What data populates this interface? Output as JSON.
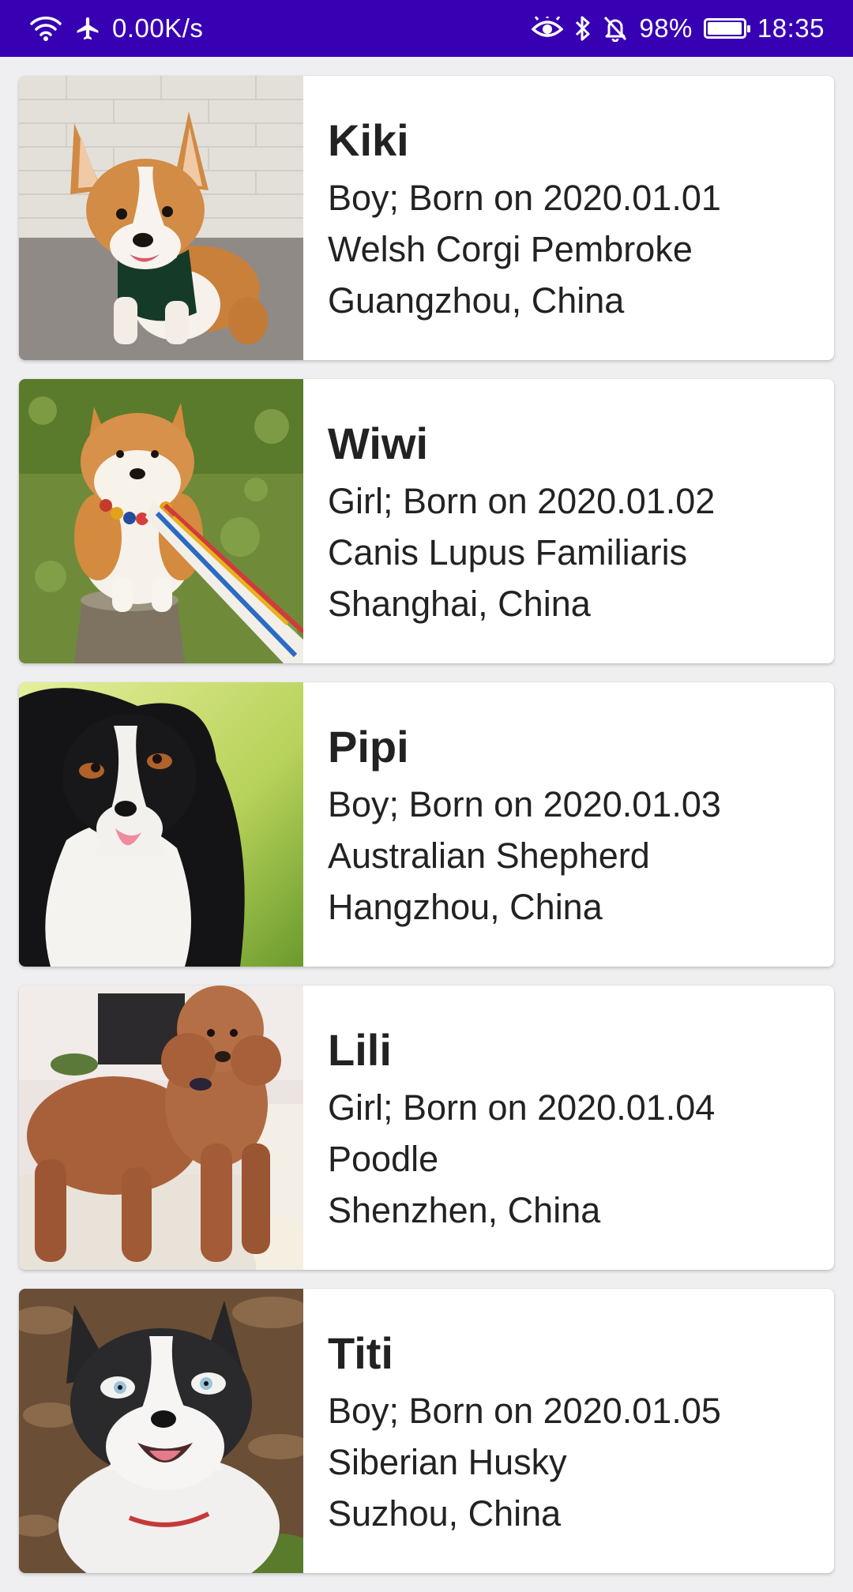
{
  "status_bar": {
    "network_speed": "0.00K/s",
    "battery_percent": "98%",
    "battery_level": 0.98,
    "time": "18:35",
    "left_icons": [
      "wifi-icon",
      "airplane-icon"
    ],
    "right_icons": [
      "eye-icon",
      "bluetooth-icon",
      "bell-off-icon",
      "battery-icon"
    ],
    "background_color": "#3700b3"
  },
  "dogs": [
    {
      "name": "Kiki",
      "gender_birth": "Boy; Born on 2020.01.01",
      "breed": "Welsh Corgi Pembroke",
      "location": "Guangzhou, China",
      "photo": "corgi-photo"
    },
    {
      "name": "Wiwi",
      "gender_birth": "Girl; Born on 2020.01.02",
      "breed": "Canis Lupus Familiaris",
      "location": "Shanghai, China",
      "photo": "shiba-photo"
    },
    {
      "name": "Pipi",
      "gender_birth": "Boy; Born on 2020.01.03",
      "breed": "Australian Shepherd",
      "location": "Hangzhou, China",
      "photo": "shepherd-photo"
    },
    {
      "name": "Lili",
      "gender_birth": "Girl; Born on 2020.01.04",
      "breed": "Poodle",
      "location": "Shenzhen, China",
      "photo": "poodle-photo"
    },
    {
      "name": "Titi",
      "gender_birth": "Boy; Born on 2020.01.05",
      "breed": "Siberian Husky",
      "location": "Suzhou, China",
      "photo": "husky-photo"
    }
  ]
}
